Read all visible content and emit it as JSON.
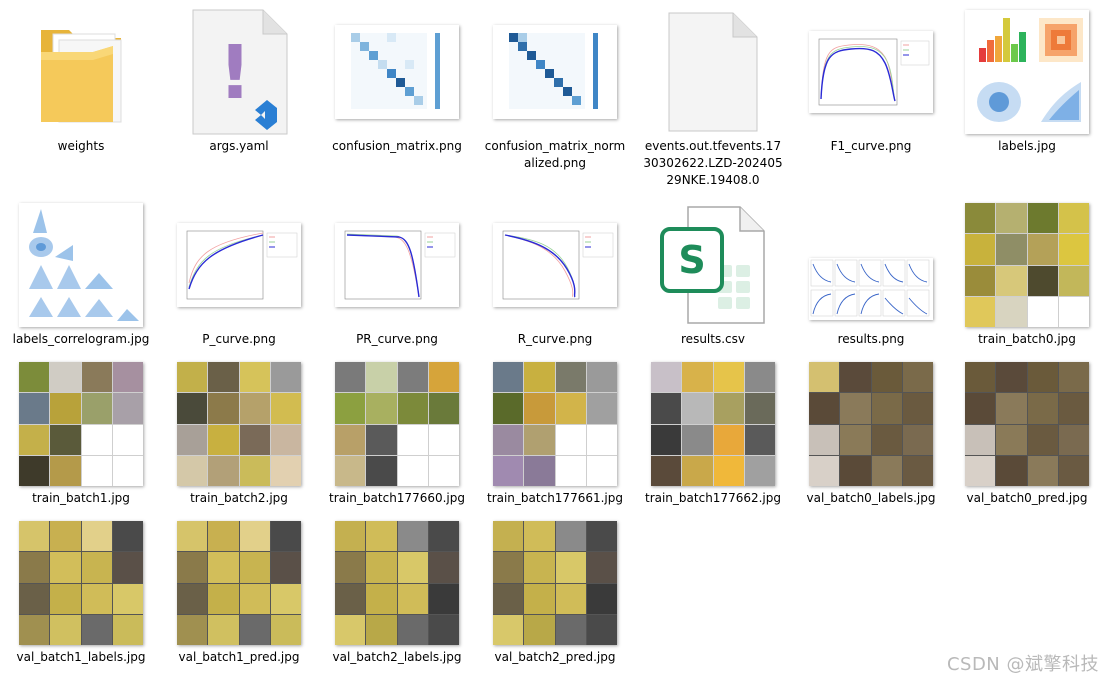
{
  "files": [
    {
      "name": "weights",
      "type": "folder"
    },
    {
      "name": "args.yaml",
      "type": "yaml"
    },
    {
      "name": "confusion_matrix.png",
      "type": "matrix"
    },
    {
      "name": "confusion_matrix_normalized.png",
      "type": "matrix-normalized"
    },
    {
      "name": "events.out.tfevents.1730302622.LZD-20240529NKE.19408.0",
      "type": "blank-file"
    },
    {
      "name": "F1_curve.png",
      "type": "curve"
    },
    {
      "name": "labels.jpg",
      "type": "labels"
    },
    {
      "name": "labels_correlogram.jpg",
      "type": "correlogram"
    },
    {
      "name": "P_curve.png",
      "type": "curve"
    },
    {
      "name": "PR_curve.png",
      "type": "curve"
    },
    {
      "name": "R_curve.png",
      "type": "curve"
    },
    {
      "name": "results.csv",
      "type": "csv"
    },
    {
      "name": "results.png",
      "type": "results"
    },
    {
      "name": "train_batch0.jpg",
      "type": "train"
    },
    {
      "name": "train_batch1.jpg",
      "type": "train"
    },
    {
      "name": "train_batch2.jpg",
      "type": "train"
    },
    {
      "name": "train_batch177660.jpg",
      "type": "train"
    },
    {
      "name": "train_batch177661.jpg",
      "type": "train"
    },
    {
      "name": "train_batch177662.jpg",
      "type": "train"
    },
    {
      "name": "val_batch0_labels.jpg",
      "type": "val"
    },
    {
      "name": "val_batch0_pred.jpg",
      "type": "val"
    },
    {
      "name": "val_batch1_labels.jpg",
      "type": "val"
    },
    {
      "name": "val_batch1_pred.jpg",
      "type": "val"
    },
    {
      "name": "val_batch2_labels.jpg",
      "type": "val"
    },
    {
      "name": "val_batch2_pred.jpg",
      "type": "val"
    }
  ],
  "icons": {
    "csv_letter": "S",
    "yaml_mark": "!"
  },
  "colors": {
    "folder": "#f5c95a",
    "matrix": "#1f5a96",
    "csv_green": "#1e8c5a",
    "curve_line": "#2b2bd6"
  },
  "watermark": "CSDN @斌擎科技"
}
